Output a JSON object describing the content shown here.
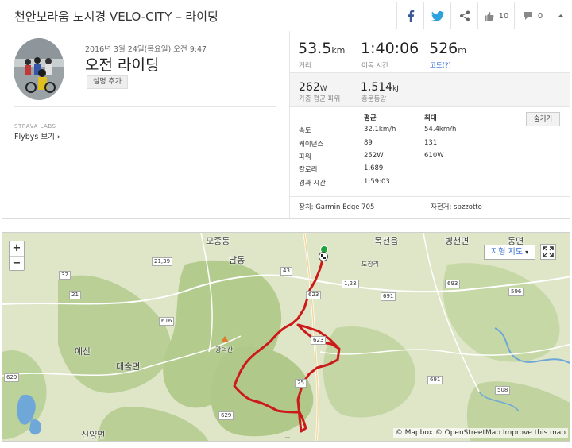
{
  "header": {
    "title": "천안보라움 노시경 VELO-CITY – 라이딩",
    "kudos_count": "10",
    "comment_count": "0"
  },
  "activity": {
    "date": "2016년 3월 24일(목요일) 오전 9:47",
    "name": "오전 라이딩",
    "add_description": "설명 추가",
    "labs_label": "STRAVA LABS",
    "flybys_label": "Flybys 보기"
  },
  "stats": {
    "distance": {
      "value": "53.5",
      "unit": "km",
      "label": "거리"
    },
    "moving_time": {
      "value": "1:40:06",
      "label": "이동 시간"
    },
    "elevation": {
      "value": "526",
      "unit": "m",
      "label": "고도(?)"
    },
    "weighted_power": {
      "value": "262",
      "unit": "W",
      "label": "가중 평균 파워"
    },
    "total_work": {
      "value": "1,514",
      "unit": "kJ",
      "label": "총운동량"
    }
  },
  "table": {
    "col_avg": "평균",
    "col_max": "최대",
    "hide_button": "숨기기",
    "rows": [
      {
        "label": "속도",
        "avg": "32.1km/h",
        "max": "54.4km/h"
      },
      {
        "label": "케이던스",
        "avg": "89",
        "max": "131"
      },
      {
        "label": "파워",
        "avg": "252W",
        "max": "610W"
      },
      {
        "label": "칼로리",
        "avg": "1,689",
        "max": ""
      },
      {
        "label": "경과 시간",
        "avg": "1:59:03",
        "max": ""
      }
    ],
    "device": "장치: Garmin Edge 705",
    "bike": "자전거: spzzotto"
  },
  "map": {
    "zoom_in": "+",
    "zoom_out": "−",
    "map_type": "지형 지도",
    "attribution": "© Mapbox © OpenStreetMap Improve this map",
    "labels": [
      "모종동",
      "목천읍",
      "병천면",
      "동면",
      "남동",
      "도장리",
      "광덕산",
      "예산",
      "대술면",
      "신양면"
    ],
    "road_numbers": [
      "21,39",
      "43",
      "32",
      "21",
      "616",
      "1,23",
      "623",
      "693",
      "691",
      "596",
      "629",
      "691",
      "25",
      "623",
      "508",
      "629"
    ],
    "colors": {
      "route": "#cc1a1a",
      "terrain": "#dfe6c8",
      "forest": "#b9cf96",
      "water": "#6fa7d8"
    }
  }
}
